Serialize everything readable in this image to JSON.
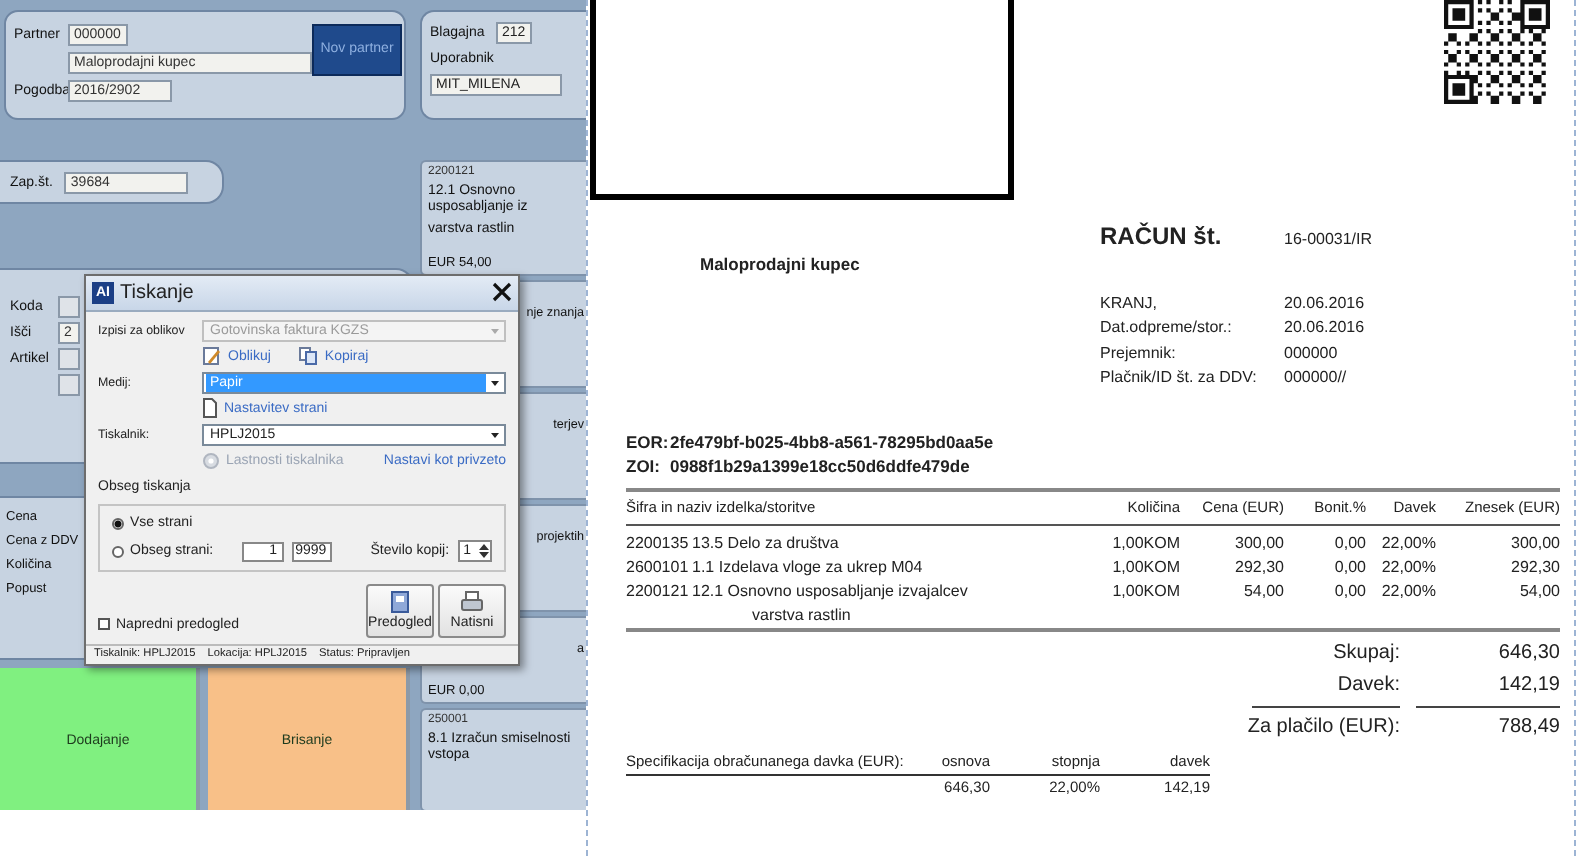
{
  "app": {
    "partner": {
      "label": "Partner",
      "code": "000000",
      "name": "Maloprodajni kupec",
      "contract_label": "Pogodba",
      "contract": "2016/2902",
      "new_button": "Nov partner"
    },
    "register": {
      "label": "Blagajna",
      "value": "212",
      "user_label": "Uporabnik",
      "user": "MIT_MILENA"
    },
    "entry": {
      "label": "Zap.št.",
      "value": "39684"
    },
    "article": {
      "code_label": "Koda",
      "search_label": "Išči",
      "search_value": "2",
      "article_label": "Artikel"
    },
    "price_labels": [
      "Cena",
      "Cena z DDV",
      "Količina",
      "Popust"
    ],
    "actions": [
      {
        "label": "Dodajanje",
        "color": "#80f080"
      },
      {
        "label": "Brisanje",
        "color": "#f8c088"
      }
    ],
    "cards": [
      {
        "kind": "full",
        "code": "2200121",
        "name": "12.1 Osnovno usposabljanje iz",
        "name2": "varstva rastlin",
        "price": "EUR 54,00"
      },
      {
        "kind": "clipped",
        "name": "nje znanja"
      },
      {
        "kind": "clipped",
        "name": "terjev"
      },
      {
        "kind": "clipped",
        "name": "projektih"
      },
      {
        "kind": "clipped",
        "name": "a",
        "price": "EUR 0,00"
      },
      {
        "kind": "full",
        "code": "250001",
        "name": "8.1 Izračun smiselnosti vstopa"
      }
    ]
  },
  "dialog": {
    "logo": "AI",
    "title": "Tiskanje",
    "combos": [
      {
        "label": "Izpisi za oblikov",
        "value": "Gotovinska faktura KGZS",
        "disabled": true,
        "highlighted": false
      },
      {
        "label": "Medij:",
        "value": "Papir",
        "disabled": false,
        "highlighted": true
      },
      {
        "label": "Tiskalnik:",
        "value": "HPLJ2015",
        "disabled": false,
        "highlighted": false
      }
    ],
    "links": [
      "Oblikuj",
      "Kopiraj"
    ],
    "page_setup": "Nastavitev strani",
    "printer_properties": {
      "label": "Lastnosti tiskalnika",
      "disabled": true
    },
    "set_default": "Nastavi kot privzeto",
    "range": {
      "title": "Obseg tiskanja",
      "options": [
        {
          "label": "Vse strani",
          "selected": true
        },
        {
          "label": "Obseg strani:",
          "selected": false
        }
      ],
      "from": "1",
      "to": "9999",
      "copies_label": "Število kopij:",
      "copies": "1"
    },
    "advanced_preview": {
      "label": "Napredni predogled",
      "checked": false
    },
    "buttons": [
      {
        "label": "Predogled",
        "kind": "preview"
      },
      {
        "label": "Natisni",
        "kind": "print"
      }
    ],
    "status_bar": [
      "Tiskalnik: HPLJ2015",
      "Lokacija: HPLJ2015",
      "Status: Pripravljen"
    ]
  },
  "invoice": {
    "buyer": "Maloprodajni kupec",
    "title": "RAČUN št.",
    "number": "16-00031/IR",
    "details": [
      {
        "label": "KRANJ,",
        "value": "20.06.2016"
      },
      {
        "label": "Dat.odpreme/stor.:",
        "value": "20.06.2016"
      },
      {
        "label": "Prejemnik:",
        "value": "000000"
      },
      {
        "label": "Plačnik/ID št. za DDV:",
        "value": "000000//"
      }
    ],
    "codes": [
      {
        "label": "EOR:",
        "value": "2fe479bf-b025-4bb8-a561-78295bd0aa5e"
      },
      {
        "label": "ZOI:",
        "value": "0988f1b29a1399e18cc50d6ddfe479de"
      }
    ],
    "table": {
      "columns": [
        "Šifra in naziv izdelka/storitve",
        "Količina",
        "Cena (EUR)",
        "Bonit.%",
        "Davek",
        "Znesek (EUR)"
      ],
      "rows": [
        {
          "code": "2200135",
          "name": "13.5 Delo za društva",
          "quantity": "1,00KOM",
          "price": "300,00",
          "discount": "0,00",
          "tax": "22,00%",
          "amount": "300,00"
        },
        {
          "code": "2600101",
          "name": "1.1 Izdelava vloge za ukrep M04",
          "quantity": "1,00KOM",
          "price": "292,30",
          "discount": "0,00",
          "tax": "22,00%",
          "amount": "292,30"
        },
        {
          "code": "2200121",
          "name": "12.1 Osnovno usposabljanje izvajalcev",
          "name2": "varstva rastlin",
          "quantity": "1,00KOM",
          "price": "54,00",
          "discount": "0,00",
          "tax": "22,00%",
          "amount": "54,00"
        }
      ]
    },
    "totals": [
      {
        "kind": "sum",
        "label": "Skupaj:",
        "value": "646,30"
      },
      {
        "kind": "sum",
        "label": "Davek:",
        "value": "142,19"
      },
      {
        "kind": "grand",
        "label": "Za plačilo (EUR):",
        "value": "788,49"
      }
    ],
    "tax_spec": {
      "title": "Specifikacija obračunanega davka (EUR):",
      "columns": [
        "osnova",
        "stopnja",
        "davek"
      ],
      "values": [
        "646,30",
        "22,00%",
        "142,19"
      ]
    }
  }
}
